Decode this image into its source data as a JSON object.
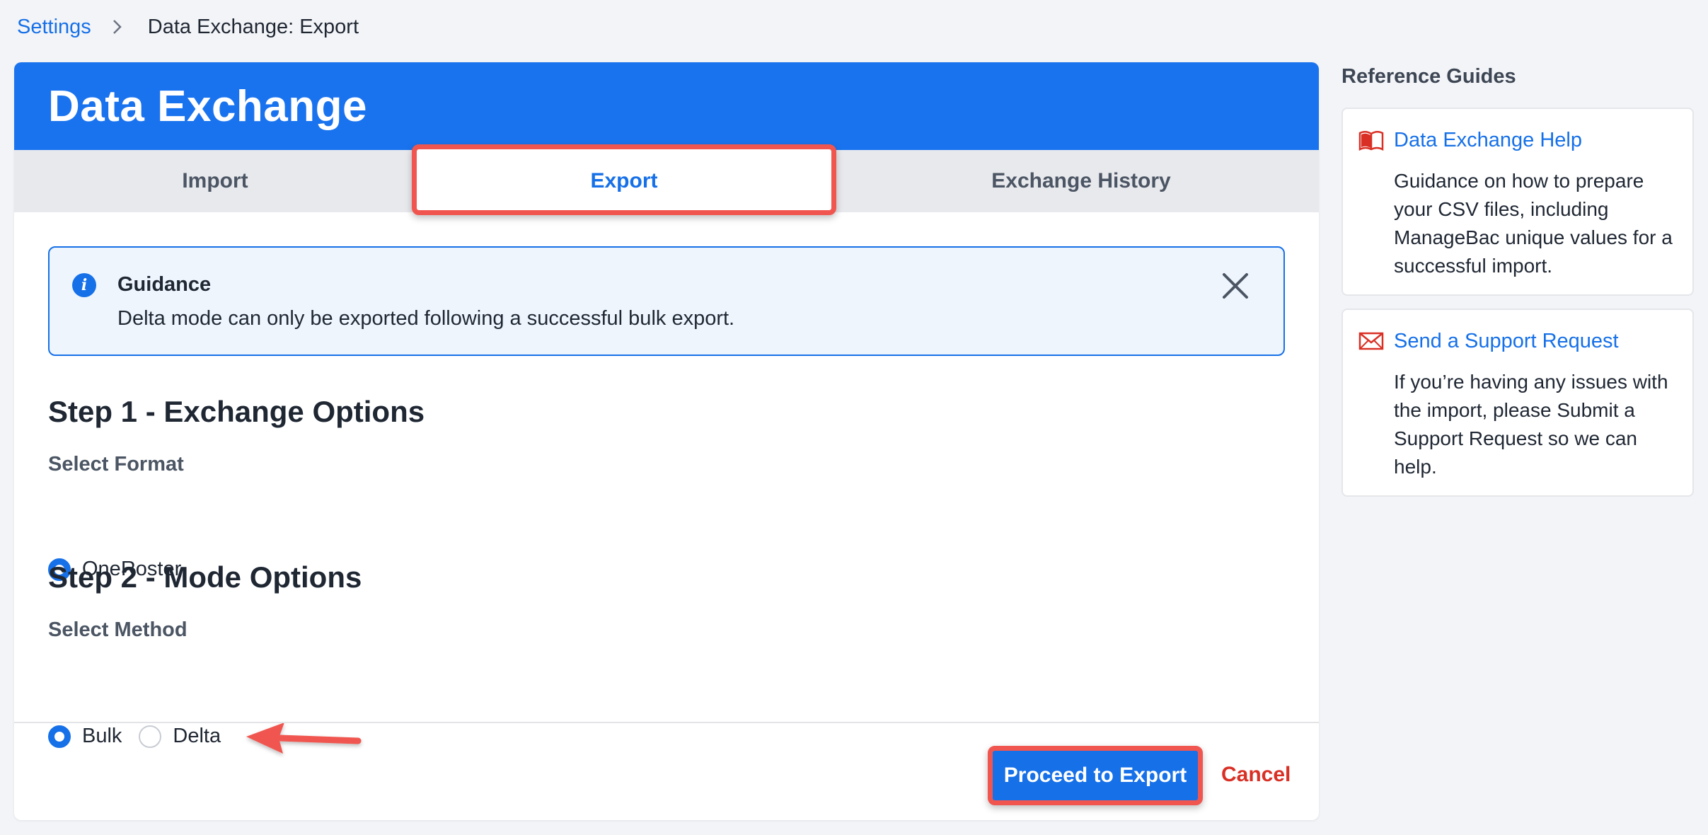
{
  "breadcrumb": {
    "parent": "Settings",
    "current": "Data Exchange: Export"
  },
  "page": {
    "title": "Data Exchange"
  },
  "tabs": [
    {
      "label": "Import",
      "active": false
    },
    {
      "label": "Export",
      "active": true
    },
    {
      "label": "Exchange History",
      "active": false
    }
  ],
  "guidance": {
    "title": "Guidance",
    "text": "Delta mode can only be exported following a successful bulk export."
  },
  "step1": {
    "title": "Step 1 - Exchange Options",
    "format_label": "Select Format",
    "options": [
      {
        "label": "OneRoster",
        "checked": true
      }
    ]
  },
  "step2": {
    "title": "Step 2 - Mode Options",
    "method_label": "Select Method",
    "options": [
      {
        "label": "Bulk",
        "checked": true
      },
      {
        "label": "Delta",
        "checked": false
      }
    ]
  },
  "actions": {
    "proceed_label": "Proceed to Export",
    "cancel_label": "Cancel"
  },
  "sidebar": {
    "title": "Reference Guides",
    "guides": [
      {
        "icon": "book-icon",
        "title": "Data Exchange Help",
        "description": "Guidance on how to prepare your CSV files, including ManageBac unique values for a successful import."
      },
      {
        "icon": "envelope-icon",
        "title": "Send a Support Request",
        "description": "If you’re having any issues with the import, please Submit a Support Request so we can help."
      }
    ]
  },
  "colors": {
    "primary": "#1a73ee",
    "link": "#1670e8",
    "annotation": "#f0564f",
    "danger": "#d93025"
  }
}
